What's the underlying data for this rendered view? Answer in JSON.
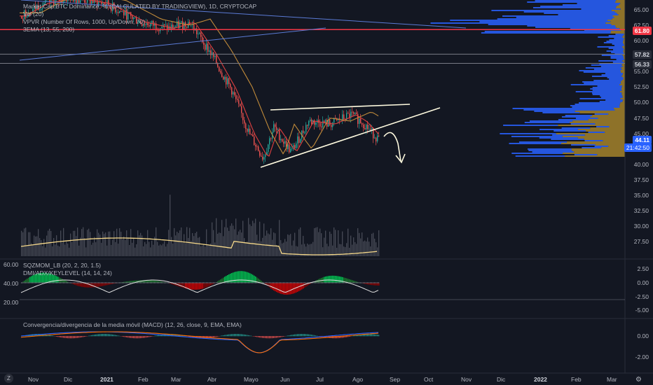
{
  "legend": {
    "main_title": "Market Cap BTC Dominance, % (CALCULATED BY TRADINGVIEW), 1D, CRYPTOCAP",
    "vol": "Vol (20)",
    "vpvr": "VPVR (Number Of Rows, 1000, Up/Down, 70)",
    "ema": "3EMA (13, 55, 200)",
    "sqzmom": "SQZMOM_LB (20, 2, 20, 1.5)",
    "dmi": "DMI/ADX/KEYLEVEL (14, 14, 24)",
    "macd": "Convergencia/divergencia de la media móvil (MACD) (12, 26, close, 9, EMA, EMA)"
  },
  "price_axis": [
    "65.00",
    "62.50",
    "60.00",
    "57.50",
    "55.00",
    "52.50",
    "50.00",
    "47.50",
    "45.00",
    "42.50",
    "40.00",
    "37.50",
    "35.00",
    "32.50",
    "30.00",
    "27.50"
  ],
  "badges": {
    "level1": "61.80",
    "level2": "57.82",
    "level3": "56.33",
    "last_price": "44.11",
    "countdown": "21:42:50"
  },
  "colors": {
    "background": "#131722",
    "red_level": "#f23645",
    "badge_blue": "#2962ff",
    "vp_blue": "#2962ff",
    "vp_gold": "#a5832a",
    "up_candle": "#26a69a",
    "down_candle": "#ef5350"
  },
  "sqz_axis_left": [
    "60.00",
    "40.00",
    "20.00"
  ],
  "sqz_axis_right": [
    "2.50",
    "0.00",
    "-2.50",
    "-5.00"
  ],
  "macd_axis": [
    "0.00",
    "-2.00"
  ],
  "time_axis": [
    "Nov",
    "Dic",
    "2021",
    "Feb",
    "Mar",
    "Abr",
    "Mayo",
    "Jun",
    "Jul",
    "Ago",
    "Sep",
    "Oct",
    "Nov",
    "Dic",
    "2022",
    "Feb",
    "Mar"
  ],
  "time_bold": [
    "2021",
    "2022"
  ],
  "controls": {
    "zoom": "Z",
    "settings_icon": "⚙"
  }
}
